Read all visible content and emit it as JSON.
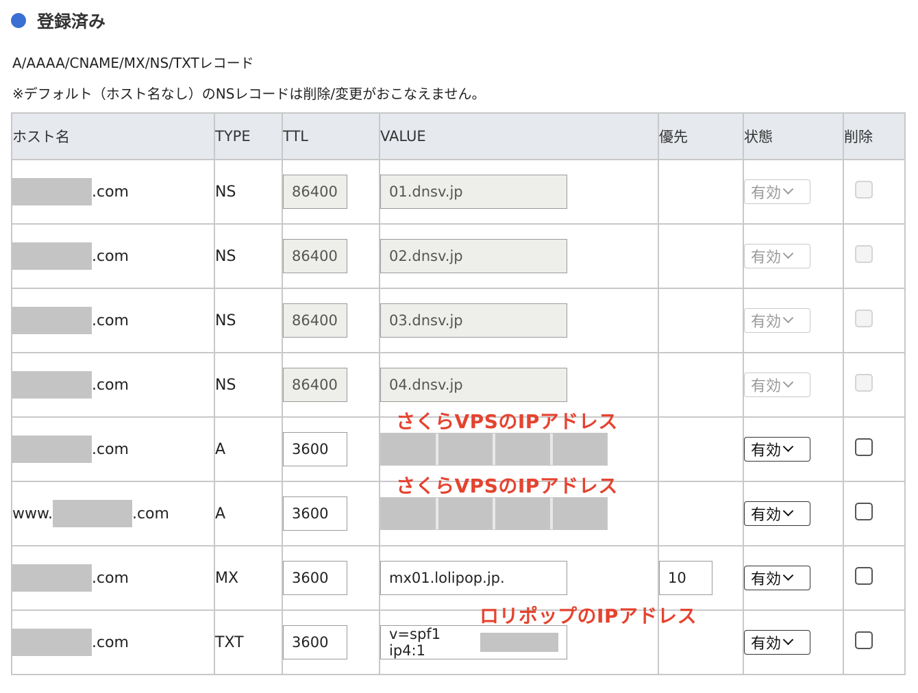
{
  "section": {
    "title": "登録済み",
    "dot_color": "#3a6fd3"
  },
  "subtitle": "A/AAAA/CNAME/MX/NS/TXTレコード",
  "note": "※デフォルト（ホスト名なし）のNSレコードは削除/変更がおこなえません。",
  "table": {
    "headers": [
      "ホスト名",
      "TYPE",
      "TTL",
      "VALUE",
      "優先",
      "状態",
      "削除"
    ],
    "rows": [
      {
        "host_prefix": "",
        "host_suffix": ".com",
        "type": "NS",
        "ttl": "86400",
        "value": "01.dnsv.jp",
        "priority": "",
        "status": "有効",
        "editable": false
      },
      {
        "host_prefix": "",
        "host_suffix": ".com",
        "type": "NS",
        "ttl": "86400",
        "value": "02.dnsv.jp",
        "priority": "",
        "status": "有効",
        "editable": false
      },
      {
        "host_prefix": "",
        "host_suffix": ".com",
        "type": "NS",
        "ttl": "86400",
        "value": "03.dnsv.jp",
        "priority": "",
        "status": "有効",
        "editable": false
      },
      {
        "host_prefix": "",
        "host_suffix": ".com",
        "type": "NS",
        "ttl": "86400",
        "value": "04.dnsv.jp",
        "priority": "",
        "status": "有効",
        "editable": false
      },
      {
        "host_prefix": "",
        "host_suffix": ".com",
        "type": "A",
        "ttl": "3600",
        "value": "",
        "priority": "",
        "status": "有効",
        "editable": true,
        "annotation": "さくらVPSのIPアドレス"
      },
      {
        "host_prefix": "www.",
        "host_suffix": ".com",
        "type": "A",
        "ttl": "3600",
        "value": "",
        "priority": "",
        "status": "有効",
        "editable": true,
        "annotation": "さくらVPSのIPアドレス"
      },
      {
        "host_prefix": "",
        "host_suffix": ".com",
        "type": "MX",
        "ttl": "3600",
        "value": "mx01.lolipop.jp.",
        "priority": "10",
        "status": "有効",
        "editable": true
      },
      {
        "host_prefix": "",
        "host_suffix": ".com",
        "type": "TXT",
        "ttl": "3600",
        "value": "v=spf1 ip4:1",
        "priority": "",
        "status": "有効",
        "editable": true,
        "annotation": "ロリポップのIPアドレス"
      }
    ]
  },
  "colors": {
    "annotation": "#e5432f",
    "header_bg": "#e6e9ee",
    "mask": "#c4c4c4"
  }
}
